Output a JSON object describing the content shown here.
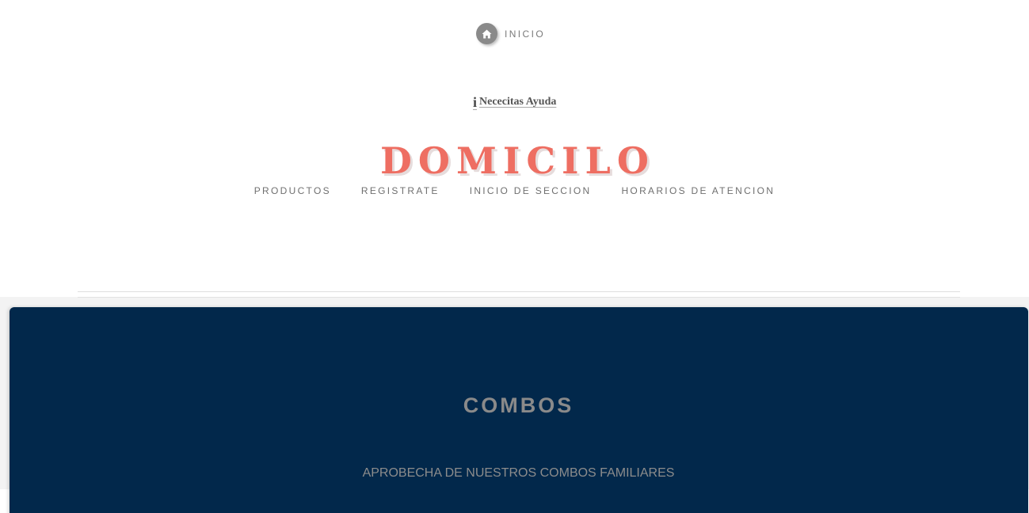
{
  "top_nav": {
    "home_label": "INICIO",
    "home_icon": "home-icon"
  },
  "help": {
    "icon": "info-icon",
    "icon_glyph": "i",
    "label": "Nececitas Ayuda"
  },
  "brand": {
    "title": "DOMICILO",
    "color": "#ee6e62"
  },
  "nav": {
    "items": [
      {
        "label": "PRODUCTOS"
      },
      {
        "label": "REGISTRATE"
      },
      {
        "label": "INICIO DE SECCION"
      },
      {
        "label": "HORARIOS DE ATENCION"
      }
    ]
  },
  "hero": {
    "title": "COMBOS",
    "subtitle": "APROBECHA DE NUESTROS COMBOS FAMILIARES",
    "background": "#02284b"
  }
}
